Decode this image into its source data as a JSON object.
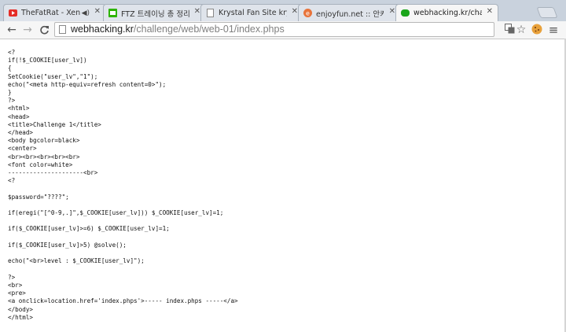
{
  "tabs": [
    {
      "title": "TheFatRat - Xenoge",
      "has_audio": true,
      "favicon": "youtube-icon",
      "color": "#e52d27"
    },
    {
      "title": "FTZ 트레이닝 총 정리",
      "has_audio": false,
      "favicon": "naver-icon",
      "color": "#2db400"
    },
    {
      "title": "Krystal Fan Site krybiye",
      "has_audio": false,
      "favicon": "page-icon",
      "color": "#888888"
    },
    {
      "title": "enjoyfun.net :: 안카에",
      "has_audio": false,
      "favicon": "enjoyfun-icon",
      "color": "#e8743b"
    },
    {
      "title": "webhacking.kr/challeng",
      "has_audio": false,
      "favicon": "site-icon",
      "color": "#1aa51a"
    }
  ],
  "tab_close_glyph": "✕",
  "audio_glyph": "◀)",
  "nav": {
    "back": "←",
    "forward": "→",
    "reload": "C"
  },
  "url": {
    "host": "webhacking.kr",
    "path": "/challenge/web/web-01/index.phps"
  },
  "toolbar_icons": {
    "translate": "翻",
    "star": "☆",
    "extension": "🍪",
    "menu": "≡"
  },
  "code_lines": [
    "<?",
    "if(!$_COOKIE[user_lv])",
    "{",
    "SetCookie(\"user_lv\",\"1\");",
    "echo(\"<meta http-equiv=refresh content=0>\");",
    "}",
    "?>",
    "<html>",
    "<head>",
    "<title>Challenge 1</title>",
    "</head>",
    "<body bgcolor=black>",
    "<center>",
    "<br><br><br><br><br>",
    "<font color=white>",
    "---------------------<br>",
    "<?",
    "",
    "$password=\"????\";",
    "",
    "if(eregi(\"[^0-9,.]\",$_COOKIE[user_lv])) $_COOKIE[user_lv]=1;",
    "",
    "if($_COOKIE[user_lv]>=6) $_COOKIE[user_lv]=1;",
    "",
    "if($_COOKIE[user_lv]>5) @solve();",
    "",
    "echo(\"<br>level : $_COOKIE[user_lv]\");",
    "",
    "?>",
    "<br>",
    "<pre>",
    "<a onclick=location.href='index.phps'>----- index.phps -----</a>",
    "</body>",
    "</html>"
  ]
}
